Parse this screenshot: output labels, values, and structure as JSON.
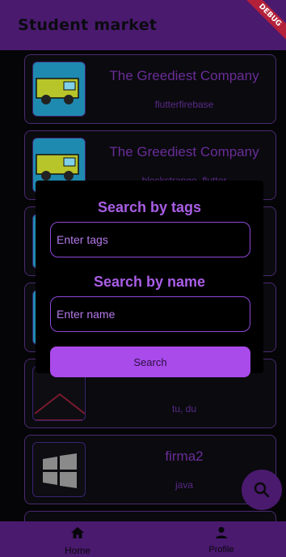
{
  "appbar": {
    "title": "Student market",
    "debug_label": "DEBUG"
  },
  "cards": [
    {
      "title": "The Greediest Company",
      "subtitle": "flutterfirebase",
      "image": "truck-icon"
    },
    {
      "title": "The Greediest Company",
      "subtitle": "blockstrange, flutter",
      "image": "truck-icon"
    },
    {
      "title": "",
      "subtitle": "",
      "image": "truck-icon"
    },
    {
      "title": "",
      "subtitle": "",
      "image": "truck-icon"
    },
    {
      "title": "",
      "subtitle": "tu, du",
      "image": "placeholder-image-icon"
    },
    {
      "title": "firma2",
      "subtitle": "java",
      "image": "windows-logo-icon"
    }
  ],
  "search_dialog": {
    "tags_heading": "Search by tags",
    "tags_placeholder": "Enter tags",
    "name_heading": "Search by name",
    "name_placeholder": "Enter name",
    "search_button": "Search"
  },
  "bottom_nav": {
    "home_label": "Home",
    "profile_label": "Profile"
  },
  "colors": {
    "accent": "#a94aeb",
    "bar": "#4a1a6e",
    "background": "#000000"
  }
}
